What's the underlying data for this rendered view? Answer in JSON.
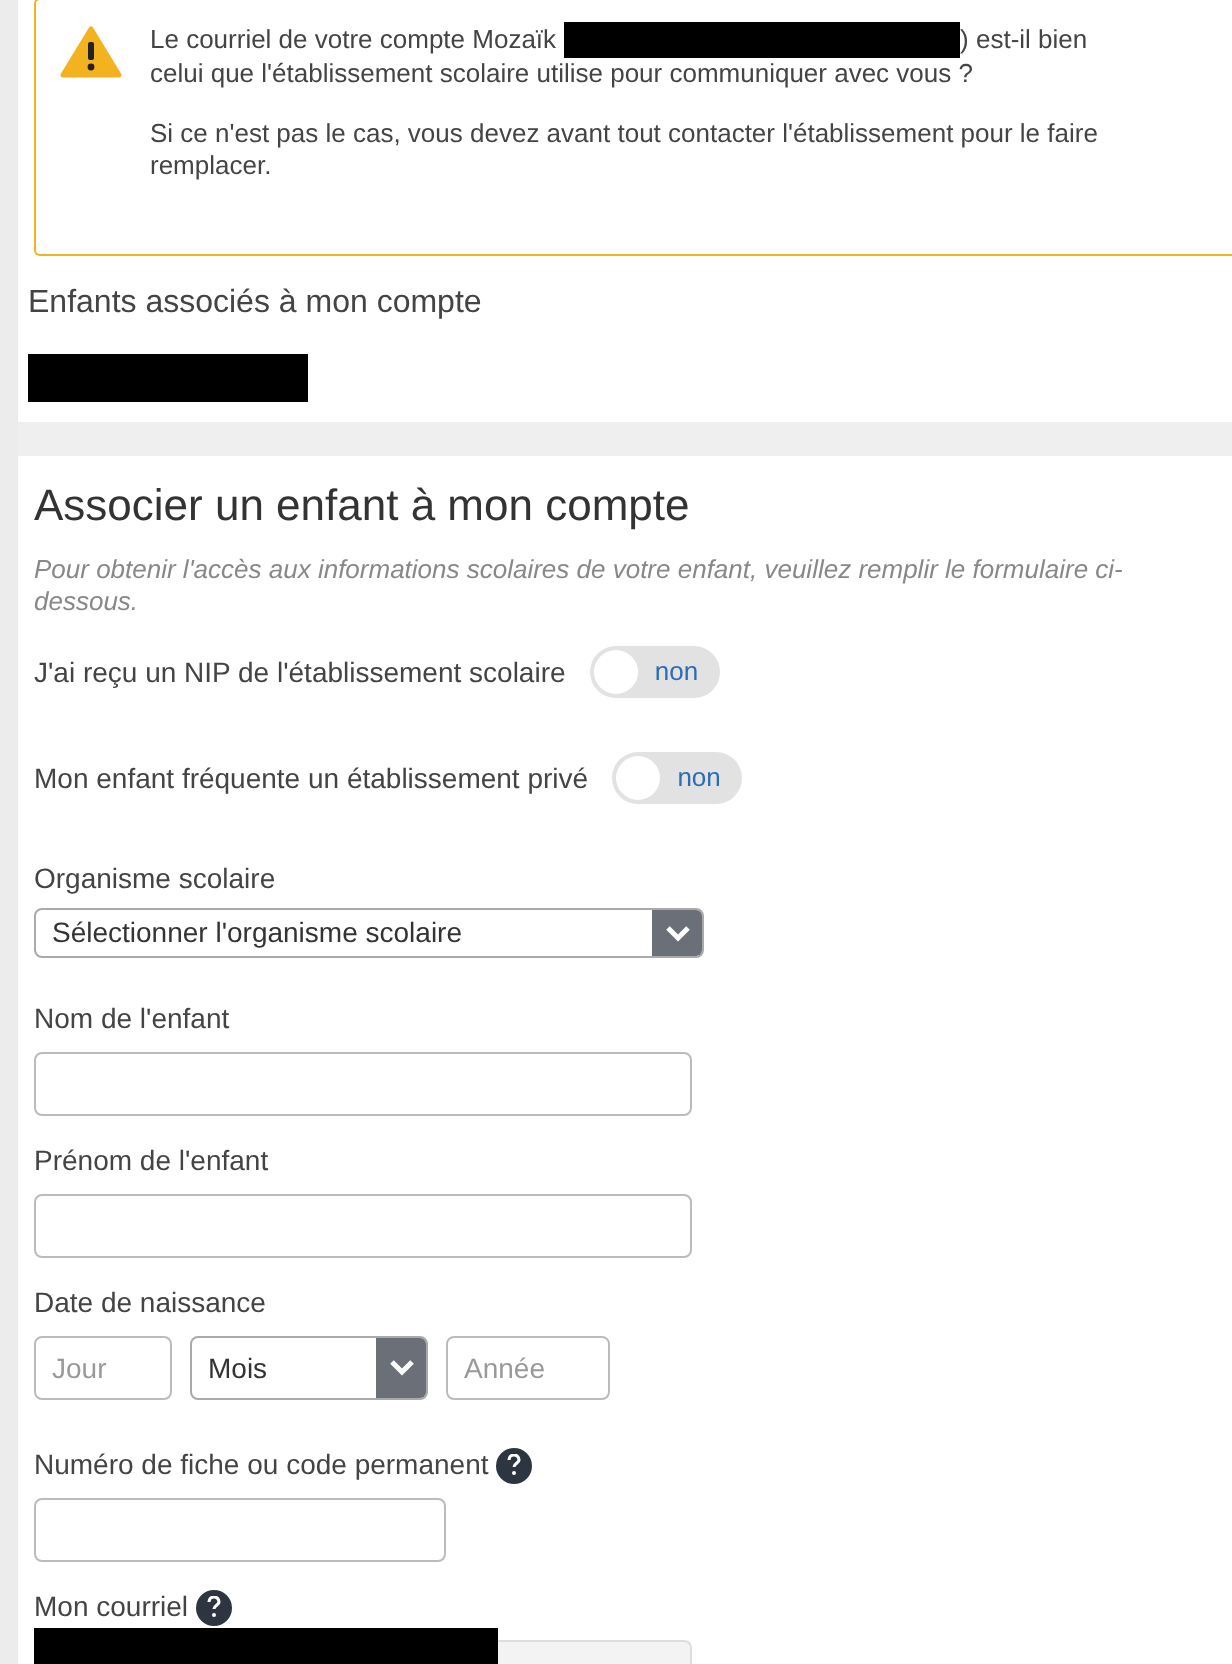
{
  "alert": {
    "line_1_start": "Le courriel de votre compte Mozaïk",
    "line_1_end": ") est-il bien",
    "line_1_next": "celui que l'établissement scolaire utilise pour communiquer avec vous ?",
    "line_2": "Si ce n'est pas le cas, vous devez avant tout contacter l'établissement pour le faire remplacer."
  },
  "children_section": {
    "title": "Enfants associés à mon compte"
  },
  "form": {
    "title": "Associer un enfant à mon compte",
    "intro": "Pour obtenir l'accès aux informations scolaires de votre enfant, veuillez remplir le formulaire ci-dessous.",
    "fields": [
      {
        "kind": "switch",
        "label": "J'ai reçu un NIP de l'établissement scolaire",
        "on": false,
        "state_text": "non"
      },
      {
        "kind": "switch",
        "label": "Mon enfant fréquente un établissement privé",
        "on": false,
        "state_text": "non"
      },
      {
        "kind": "select",
        "label": "Organisme scolaire",
        "value": "Sélectionner l'organisme scolaire"
      },
      {
        "kind": "text",
        "label": "Nom de l'enfant"
      },
      {
        "kind": "text",
        "label": "Prénom de l'enfant"
      },
      {
        "kind": "date",
        "label": "Date de naissance",
        "day_placeholder": "Jour",
        "month_value": "Mois",
        "year_placeholder": "Année"
      },
      {
        "kind": "short_text",
        "label": "Numéro de fiche ou code permanent",
        "help": true
      },
      {
        "kind": "email",
        "label": "Mon courriel",
        "help": true
      }
    ]
  }
}
